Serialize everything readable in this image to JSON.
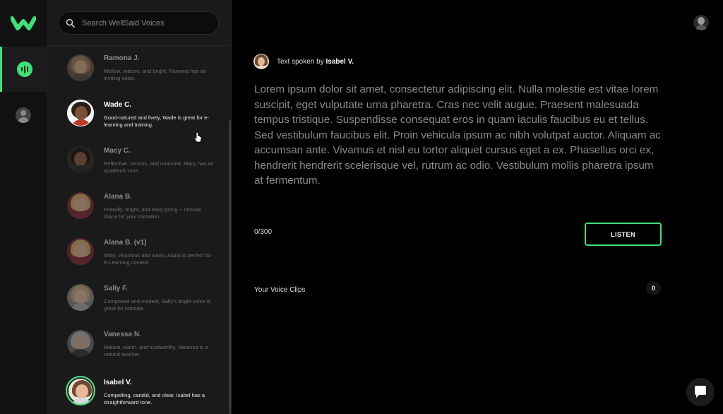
{
  "app": {
    "accent_color": "#3ee07a",
    "logo_icon": "wellsaid-logo-icon"
  },
  "nav": {
    "items": [
      {
        "name": "voices",
        "icon": "voice-wave-icon",
        "active": true
      },
      {
        "name": "account",
        "icon": "user-icon",
        "active": false
      }
    ]
  },
  "search": {
    "placeholder": "Search WellSaid Voices",
    "icon": "search-icon"
  },
  "voices": [
    {
      "name": "Ramona J.",
      "description": "Mellow, mature, and bright, Ramona has an inviting voice."
    },
    {
      "name": "Wade C.",
      "description": "Good-natured and lively, Wade is great for e-learning and training."
    },
    {
      "name": "Macy C.",
      "description": "Reflective, serious, and nuanced, Macy has an academic tone."
    },
    {
      "name": "Alana B.",
      "description": "Friendly, bright, and easy-going -- choose Alana for your narration."
    },
    {
      "name": "Alana B. (v1)",
      "description": "Witty, vivacious and warm, Alana is perfect for E-Learning content."
    },
    {
      "name": "Sally F.",
      "description": "Composed and modest, Sally's bright voice is great for tutorials."
    },
    {
      "name": "Vanessa N.",
      "description": "Mature, warm, and trustworthy, Vanessa is a natural teacher."
    },
    {
      "name": "Isabel V.",
      "description": "Compelling, candid, and clear, Isabel has a straightforward tone."
    }
  ],
  "editor": {
    "spoken_prefix": "Text spoken by ",
    "spoken_name": "Isabel V.",
    "text": "Lorem ipsum dolor sit amet, consectetur adipiscing elit. Nulla molestie est vitae lorem suscipit, eget vulputate urna pharetra. Cras nec velit augue. Praesent malesuada tempus tristique. Suspendisse consequat eros in quam iaculis faucibus eu et tellus. Sed vestibulum faucibus elit. Proin vehicula ipsum ac nibh volutpat auctor. Aliquam ac accumsan ante. Vivamus et nisl eu tortor aliquet cursus eget a ex. Phasellus orci ex, hendrerit hendrerit scelerisque vel, rutrum ac odio. Vestibulum mollis pharetra ipsum at fermentum.",
    "counter": "0/300",
    "listen_label": "LISTEN"
  },
  "clips": {
    "label": "Your Voice Clips",
    "count": "0"
  },
  "chat": {
    "icon": "chat-bubble-icon"
  }
}
